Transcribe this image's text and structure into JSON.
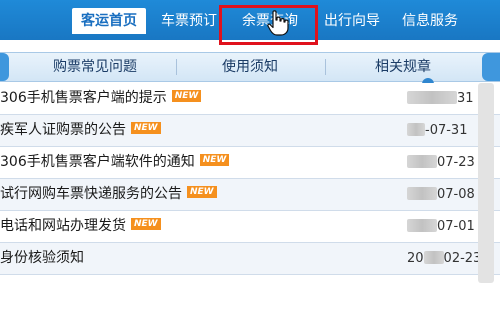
{
  "nav": {
    "items": [
      {
        "label": "客运首页",
        "active": true
      },
      {
        "label": "车票预订",
        "active": false
      },
      {
        "label": "余票查询",
        "active": false
      },
      {
        "label": "出行向导",
        "active": false
      },
      {
        "label": "信息服务",
        "active": false
      }
    ]
  },
  "subnav": {
    "tabs": [
      "购票常见问题",
      "使用须知",
      "相关规章"
    ]
  },
  "notices": [
    {
      "title": "306手机售票客户端的提示",
      "new": true,
      "date": "31"
    },
    {
      "title": "疾军人证购票的公告",
      "new": true,
      "date": "-07-31"
    },
    {
      "title": "306手机售票客户端软件的通知",
      "new": true,
      "date": "07-23"
    },
    {
      "title": "试行网购车票快递服务的公告",
      "new": true,
      "date": "07-08"
    },
    {
      "title": "电话和网站办理发货",
      "new": true,
      "date": "07-01"
    },
    {
      "title": "身份核验须知",
      "new": false,
      "date_prefix": "20",
      "date": "02-23"
    }
  ],
  "badge_label": "NEW",
  "colors": {
    "nav_bg": "#1977c3",
    "highlight": "#e0121c",
    "badge": "#f5901e"
  }
}
